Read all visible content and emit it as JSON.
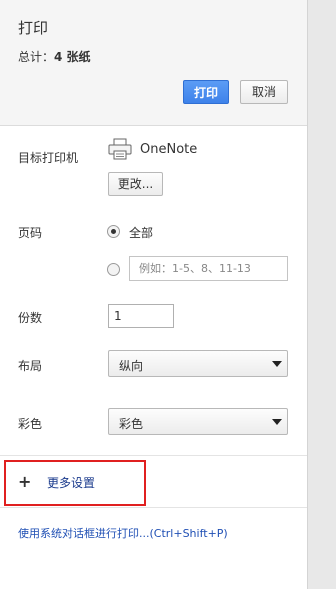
{
  "header": {
    "title": "打印",
    "total_prefix": "总计：",
    "total_value": "4 张纸",
    "print_button": "打印",
    "cancel_button": "取消"
  },
  "destination": {
    "label": "目标打印机",
    "printer_name": "OneNote",
    "change_button": "更改..."
  },
  "pages": {
    "label": "页码",
    "option_all": "全部",
    "custom_placeholder": "例如：1-5、8、11-13"
  },
  "copies": {
    "label": "份数",
    "value": "1"
  },
  "layout": {
    "label": "布局",
    "selected": "纵向"
  },
  "color": {
    "label": "彩色",
    "selected": "彩色"
  },
  "more_settings": "更多设置",
  "system_dialog_link": "使用系统对话框进行打印...(Ctrl+Shift+P)",
  "colors": {
    "print_button": "#3e82ea",
    "highlight_box": "#e02020",
    "link": "#1f4fb4"
  }
}
